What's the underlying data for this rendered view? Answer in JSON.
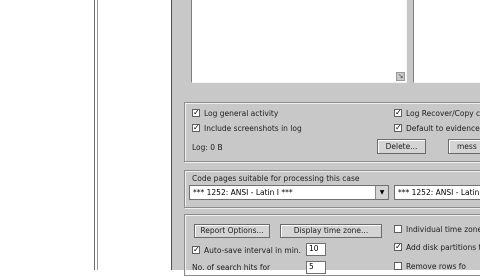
{
  "logging": {
    "log_general_activity": {
      "label": "Log general activity",
      "checked": true
    },
    "include_screenshots": {
      "label": "Include screenshots in log",
      "checked": true
    },
    "log_recover_copy": {
      "label": "Log Recover/Copy c",
      "checked": true
    },
    "default_to_evidence": {
      "label": "Default to evidence",
      "checked": true
    },
    "log_size": "Log: 0 B",
    "delete_button": "Delete...",
    "message_button": "mess"
  },
  "codepage": {
    "label": "Code pages suitable for processing this case",
    "primary_value": "*** 1252: ANSI - Latin I ***",
    "secondary_value": "*** 1252: ANSI - Latin I"
  },
  "bottom": {
    "report_options_button": "Report Options...",
    "display_time_zone_button": "Display time zone...",
    "individual_time_zones": {
      "label": "Individual time zones",
      "checked": false
    },
    "autosave": {
      "label": "Auto-save interval in min.",
      "checked": true,
      "value": "10"
    },
    "add_disk_partitions": {
      "label": "Add disk partitions to",
      "checked": true
    },
    "no_of_search_hits": {
      "label": "No. of search hits for",
      "value": "5"
    },
    "remove_rows": {
      "label": "Remove rows fo",
      "checked": false
    }
  }
}
